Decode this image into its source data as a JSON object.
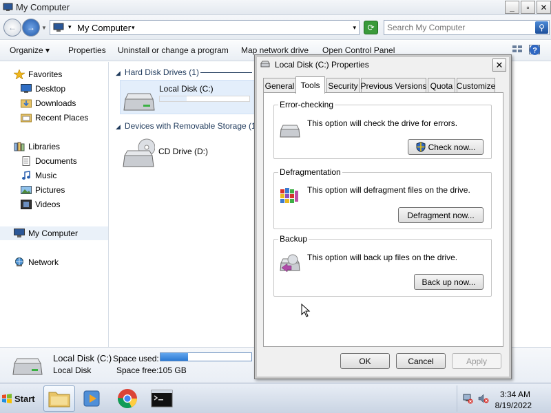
{
  "explorer": {
    "title": "My Computer",
    "window_buttons": {
      "minimize": "_",
      "maximize": "▫",
      "close": "✕"
    },
    "address": {
      "crumb": "My Computer",
      "separator": "▾",
      "arrow": "▾",
      "dropdown": "▾"
    },
    "search": {
      "placeholder": "Search My Computer"
    },
    "toolbar": {
      "organize": "Organize",
      "organize_arrow": "▾",
      "properties": "Properties",
      "uninstall": "Uninstall or change a program",
      "map_drive": "Map network drive",
      "control_panel": "Open Control Panel",
      "view_arrow": "▾"
    },
    "sidebar": {
      "favorites": "Favorites",
      "desktop": "Desktop",
      "downloads": "Downloads",
      "recent": "Recent Places",
      "libraries": "Libraries",
      "documents": "Documents",
      "music": "Music",
      "pictures": "Pictures",
      "videos": "Videos",
      "my_computer": "My Computer",
      "network": "Network"
    },
    "content": {
      "hdd_header": "Hard Disk Drives (1)",
      "removable_header": "Devices with Removable Storage (1)",
      "local_disk": "Local Disk (C:)",
      "cd_drive": "CD Drive (D:)",
      "local_disk_used_fraction": 0.3
    },
    "details": {
      "name": "Local Disk (C:)",
      "type": "Local Disk",
      "space_used_label": "Space used:",
      "space_free_label": "Space free:",
      "space_free_value": "105 GB",
      "space_used_fraction": 0.3
    }
  },
  "dialog": {
    "title": "Local Disk (C:) Properties",
    "close": "✕",
    "tabs": [
      "General",
      "Tools",
      "Security",
      "Previous Versions",
      "Quota",
      "Customize"
    ],
    "active_tab": "Tools",
    "error_checking": {
      "title": "Error-checking",
      "text": "This option will check the drive for errors.",
      "button": "Check now..."
    },
    "defrag": {
      "title": "Defragmentation",
      "text": "This option will defragment files on the drive.",
      "button": "Defragment now..."
    },
    "backup": {
      "title": "Backup",
      "text": "This option will back up files on the drive.",
      "button": "Back up now..."
    },
    "ok": "OK",
    "cancel": "Cancel",
    "apply": "Apply"
  },
  "taskbar": {
    "start": "Start",
    "time": "3:34 AM",
    "date": "8/19/2022"
  },
  "colors": {
    "selection": "#e3eefb",
    "group_header": "#1e395b",
    "space_bar": "#2c79d3"
  }
}
